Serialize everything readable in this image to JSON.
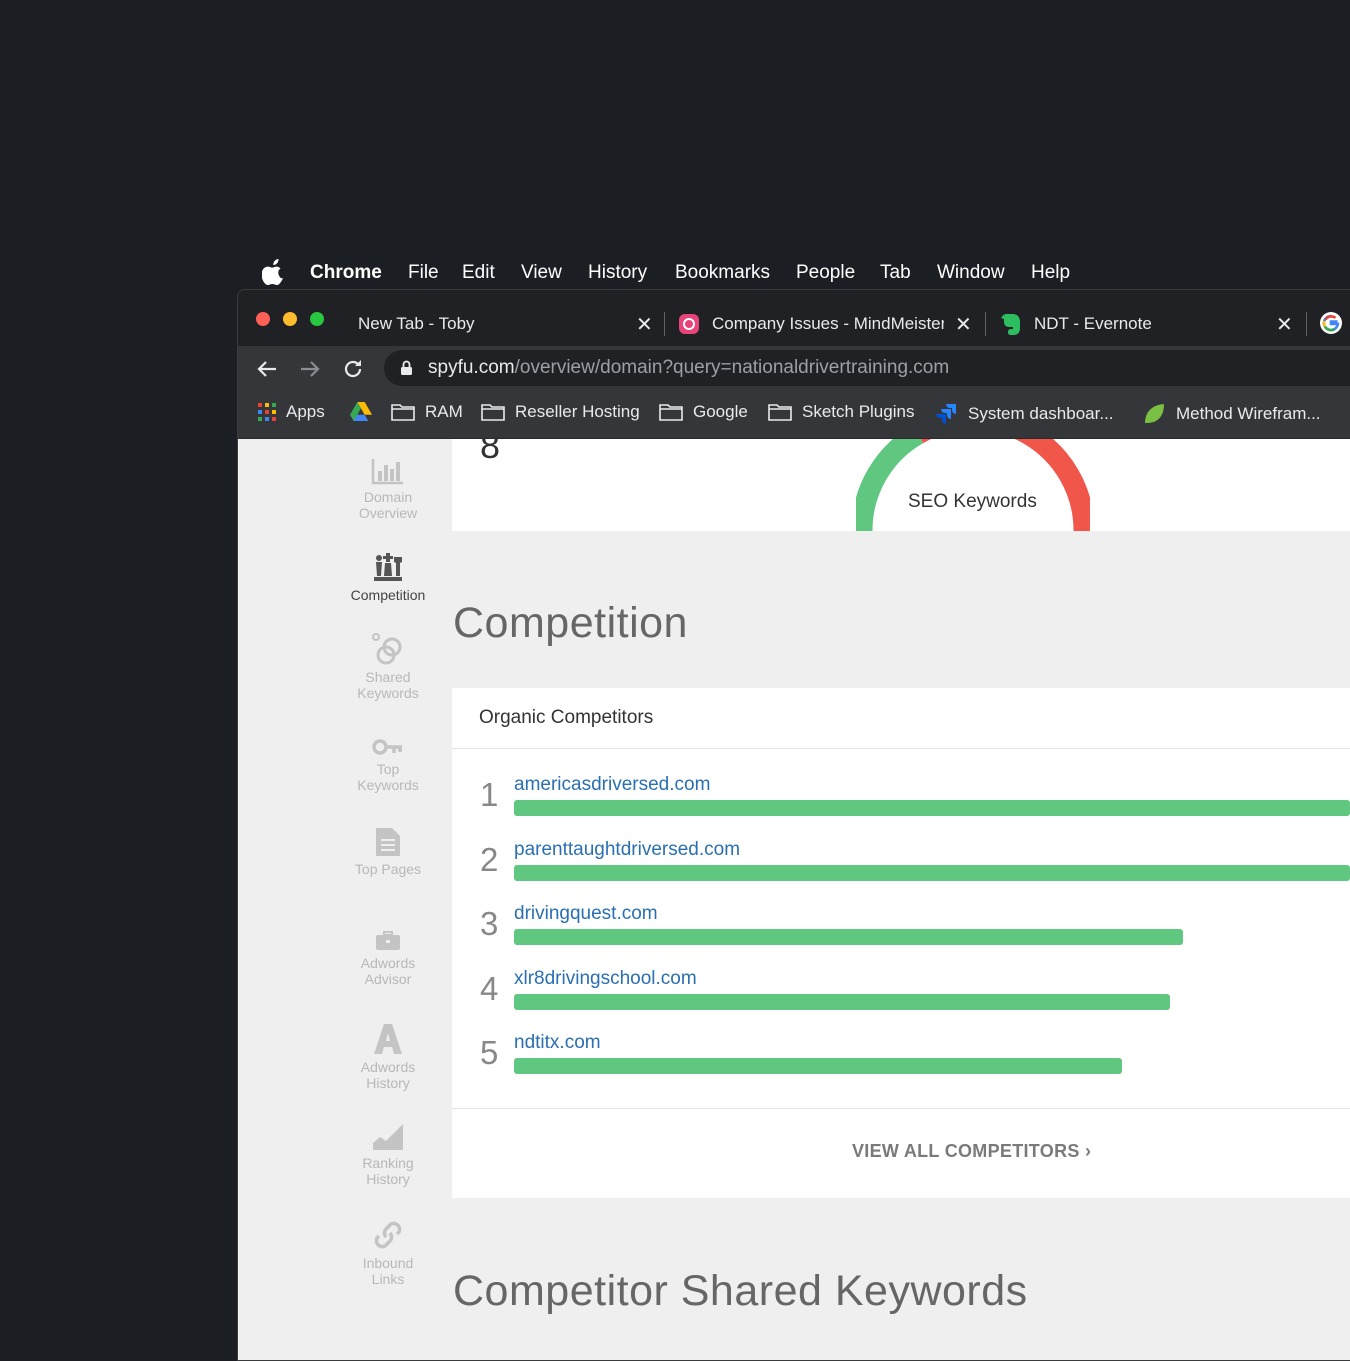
{
  "menubar": {
    "items": [
      "Chrome",
      "File",
      "Edit",
      "View",
      "History",
      "Bookmarks",
      "People",
      "Tab",
      "Window",
      "Help"
    ]
  },
  "tabs": [
    {
      "title": "New Tab - Toby",
      "icon": "none"
    },
    {
      "title": "Company Issues - MindMeister",
      "icon": "mindmeister-icon"
    },
    {
      "title": "NDT - Evernote",
      "icon": "evernote-icon"
    }
  ],
  "address": {
    "domain": "spyfu.com",
    "path": "/overview/domain?query=nationaldrivertraining.com"
  },
  "bookmarks": [
    "Apps",
    "RAM",
    "Reseller Hosting",
    "Google",
    "Sketch Plugins",
    "System dashboar...",
    "Method Wirefram..."
  ],
  "sidebar": {
    "items": [
      {
        "label": "Domain Overview",
        "icon": "bar-chart-icon",
        "active": false
      },
      {
        "label": "Competition",
        "icon": "chess-pieces-icon",
        "active": true
      },
      {
        "label": "Shared Keywords",
        "icon": "linked-circles-icon",
        "active": false
      },
      {
        "label": "Top Keywords",
        "icon": "key-icon",
        "active": false
      },
      {
        "label": "Top Pages",
        "icon": "document-icon",
        "active": false
      },
      {
        "label": "Adwords Advisor",
        "icon": "briefcase-icon",
        "active": false
      },
      {
        "label": "Adwords History",
        "icon": "letter-a-icon",
        "active": false
      },
      {
        "label": "Ranking History",
        "icon": "area-chart-icon",
        "active": false
      },
      {
        "label": "Inbound Links",
        "icon": "link-icon",
        "active": false
      }
    ]
  },
  "top_card": {
    "number": "8",
    "gauge_label": "SEO Keywords",
    "colors": {
      "green": "#5fc77f",
      "red": "#f0564a"
    }
  },
  "competition": {
    "heading": "Competition",
    "card_title": "Organic Competitors",
    "rows": [
      {
        "rank": "1",
        "domain": "americasdriversed.com",
        "strength": 1.0
      },
      {
        "rank": "2",
        "domain": "parenttaughtdriversed.com",
        "strength": 1.0
      },
      {
        "rank": "3",
        "domain": "drivingquest.com",
        "strength": 0.8
      },
      {
        "rank": "4",
        "domain": "xlr8drivingschool.com",
        "strength": 0.785
      },
      {
        "rank": "5",
        "domain": "ndtitx.com",
        "strength": 0.727
      }
    ],
    "view_all": "VIEW ALL COMPETITORS ›"
  },
  "shared_keywords": {
    "heading": "Competitor Shared Keywords"
  }
}
